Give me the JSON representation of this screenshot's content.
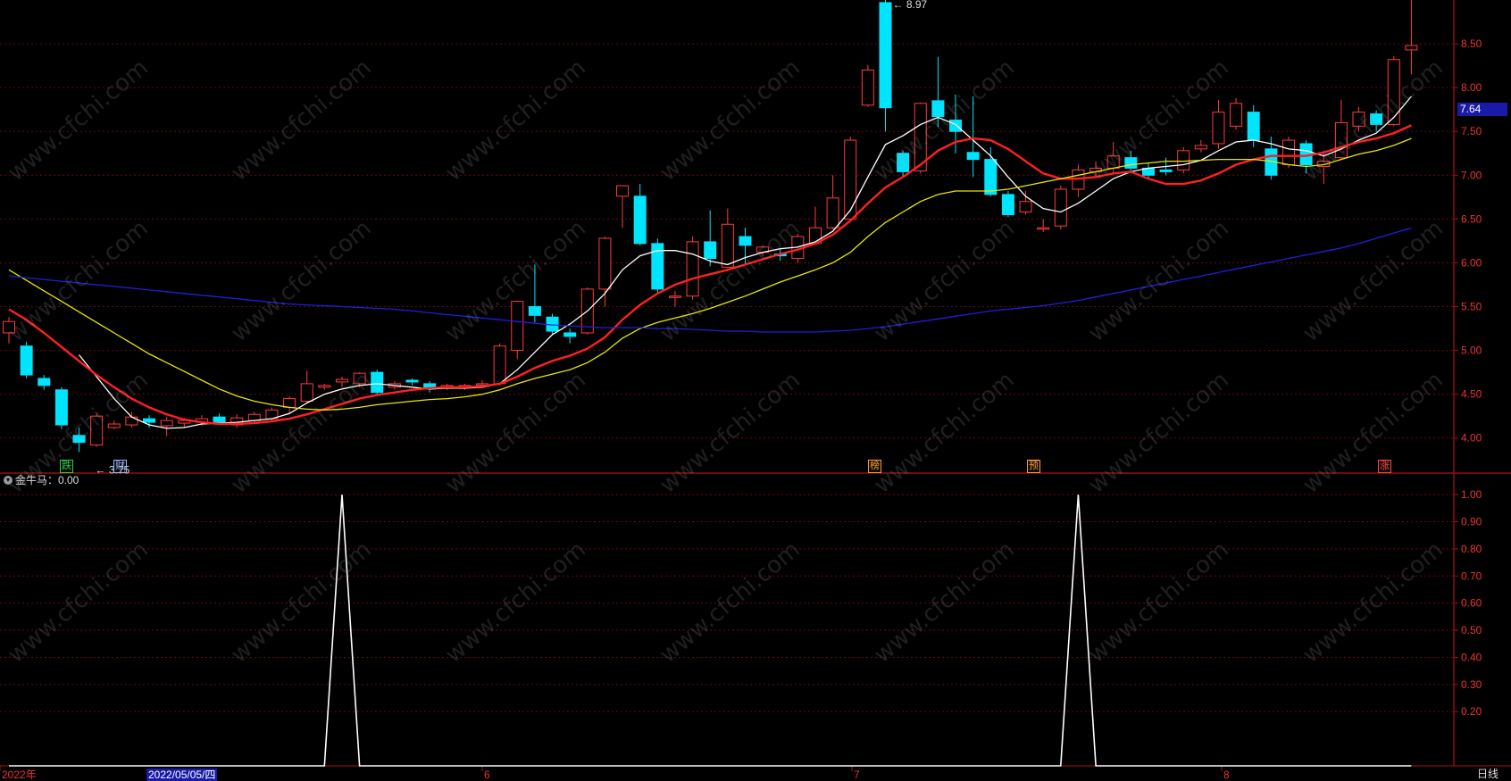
{
  "watermark": "www.cfchi.com",
  "indicator": {
    "label": "金牛马：0.00"
  },
  "price_tag": "7.64",
  "period_label": "日线",
  "cursor_date": "2022/05/05/四",
  "tags": [
    {
      "text": "跌",
      "color": "#2ecc40"
    },
    {
      "text": "财",
      "color": "#8fb3ff"
    },
    {
      "text": "榜",
      "color": "#ff9933"
    },
    {
      "text": "预",
      "color": "#ff9933"
    },
    {
      "text": "涨",
      "color": "#ff4444"
    }
  ],
  "chart_data": [
    {
      "type": "candlestick",
      "ylim": [
        3.6,
        9.0
      ],
      "yticks": [
        "4.00",
        "4.50",
        "5.00",
        "5.50",
        "6.00",
        "6.50",
        "7.00",
        "7.50",
        "8.00",
        "8.50"
      ],
      "xticks": [
        "2022年",
        "6",
        "7",
        "8"
      ],
      "high_annotation": "8.97",
      "low_annotation": "3.75",
      "candles": [
        [
          5.2,
          5.33,
          5.38,
          5.08
        ],
        [
          5.05,
          4.72,
          5.1,
          4.68
        ],
        [
          4.68,
          4.6,
          4.72,
          4.55
        ],
        [
          4.55,
          4.15,
          4.58,
          4.1
        ],
        [
          4.03,
          3.95,
          4.12,
          3.84
        ],
        [
          3.92,
          4.25,
          4.28,
          3.9
        ],
        [
          4.12,
          4.16,
          4.2,
          4.1
        ],
        [
          4.15,
          4.24,
          4.3,
          4.12
        ],
        [
          4.22,
          4.18,
          4.26,
          4.12
        ],
        [
          4.14,
          4.2,
          4.24,
          4.02
        ],
        [
          4.17,
          4.2,
          4.23,
          4.12
        ],
        [
          4.18,
          4.22,
          4.26,
          4.14
        ],
        [
          4.24,
          4.18,
          4.28,
          4.16
        ],
        [
          4.15,
          4.23,
          4.27,
          4.12
        ],
        [
          4.2,
          4.27,
          4.3,
          4.16
        ],
        [
          4.22,
          4.32,
          4.35,
          4.2
        ],
        [
          4.35,
          4.45,
          4.48,
          4.28
        ],
        [
          4.42,
          4.62,
          4.77,
          4.4
        ],
        [
          4.58,
          4.6,
          4.62,
          4.55
        ],
        [
          4.64,
          4.67,
          4.7,
          4.58
        ],
        [
          4.62,
          4.74,
          4.75,
          4.58
        ],
        [
          4.75,
          4.52,
          4.78,
          4.5
        ],
        [
          4.58,
          4.62,
          4.65,
          4.55
        ],
        [
          4.66,
          4.64,
          4.68,
          4.6
        ],
        [
          4.62,
          4.56,
          4.65,
          4.52
        ],
        [
          4.58,
          4.6,
          4.62,
          4.55
        ],
        [
          4.58,
          4.6,
          4.62,
          4.55
        ],
        [
          4.62,
          4.62,
          4.66,
          4.6
        ],
        [
          4.62,
          5.05,
          5.08,
          4.6
        ],
        [
          5.0,
          5.56,
          5.57,
          4.9
        ],
        [
          5.5,
          5.4,
          5.98,
          5.32
        ],
        [
          5.38,
          5.22,
          5.42,
          5.18
        ],
        [
          5.2,
          5.16,
          5.25,
          5.08
        ],
        [
          5.2,
          5.7,
          5.72,
          5.18
        ],
        [
          5.7,
          6.28,
          6.3,
          5.5
        ],
        [
          6.76,
          6.88,
          6.88,
          6.4
        ],
        [
          6.76,
          6.22,
          6.9,
          6.2
        ],
        [
          6.22,
          5.7,
          6.28,
          5.65
        ],
        [
          5.62,
          5.62,
          5.68,
          5.5
        ],
        [
          5.62,
          6.24,
          6.3,
          5.58
        ],
        [
          6.24,
          6.05,
          6.6,
          5.96
        ],
        [
          5.95,
          6.44,
          6.62,
          5.94
        ],
        [
          6.3,
          6.2,
          6.4,
          5.98
        ],
        [
          6.12,
          6.18,
          6.2,
          6.08
        ],
        [
          6.1,
          6.08,
          6.15,
          6.02
        ],
        [
          6.05,
          6.3,
          6.33,
          6.0
        ],
        [
          6.22,
          6.4,
          6.64,
          6.2
        ],
        [
          6.4,
          6.74,
          7.0,
          6.38
        ],
        [
          6.5,
          7.4,
          7.44,
          6.5
        ],
        [
          7.8,
          8.2,
          8.26,
          7.78
        ],
        [
          8.97,
          7.77,
          9.0,
          7.5
        ],
        [
          7.25,
          7.04,
          7.28,
          6.98
        ],
        [
          7.05,
          7.82,
          7.83,
          7.02
        ],
        [
          7.85,
          7.67,
          8.35,
          7.55
        ],
        [
          7.63,
          7.5,
          7.92,
          7.25
        ],
        [
          7.26,
          7.18,
          7.9,
          6.98
        ],
        [
          7.18,
          6.78,
          7.32,
          6.76
        ],
        [
          6.78,
          6.55,
          6.82,
          6.52
        ],
        [
          6.58,
          6.7,
          6.82,
          6.55
        ],
        [
          6.4,
          6.4,
          6.5,
          6.35
        ],
        [
          6.42,
          6.84,
          6.88,
          6.38
        ],
        [
          6.84,
          7.06,
          7.12,
          6.75
        ],
        [
          7.04,
          7.08,
          7.16,
          6.98
        ],
        [
          7.08,
          7.22,
          7.38,
          7.02
        ],
        [
          7.2,
          7.08,
          7.28,
          7.02
        ],
        [
          7.08,
          7.0,
          7.14,
          6.95
        ],
        [
          7.06,
          7.04,
          7.2,
          7.0
        ],
        [
          7.06,
          7.28,
          7.32,
          7.02
        ],
        [
          7.3,
          7.34,
          7.4,
          7.26
        ],
        [
          7.36,
          7.72,
          7.86,
          7.3
        ],
        [
          7.56,
          7.82,
          7.88,
          7.52
        ],
        [
          7.72,
          7.4,
          7.8,
          7.32
        ],
        [
          7.3,
          7.0,
          7.44,
          6.95
        ],
        [
          7.12,
          7.4,
          7.44,
          7.08
        ],
        [
          7.36,
          7.12,
          7.4,
          7.02
        ],
        [
          7.1,
          7.16,
          7.28,
          6.9
        ],
        [
          7.2,
          7.6,
          7.86,
          7.18
        ],
        [
          7.56,
          7.72,
          7.78,
          7.5
        ],
        [
          7.7,
          7.58,
          7.74,
          7.5
        ],
        [
          7.58,
          8.32,
          8.36,
          7.56
        ],
        [
          8.43,
          8.48,
          9.0,
          8.15
        ]
      ],
      "series": [
        {
          "color": "#ffffff",
          "values": [
            null,
            null,
            null,
            null,
            4.95,
            4.7,
            4.45,
            4.24,
            4.15,
            4.11,
            4.12,
            4.16,
            4.17,
            4.18,
            4.2,
            4.22,
            4.28,
            4.4,
            4.5,
            4.56,
            4.6,
            4.62,
            4.6,
            4.58,
            4.56,
            4.57,
            4.57,
            4.58,
            4.62,
            4.78,
            4.98,
            5.18,
            5.3,
            5.45,
            5.65,
            5.92,
            6.08,
            6.14,
            6.14,
            6.1,
            6.02,
            5.98,
            6.06,
            6.12,
            6.16,
            6.18,
            6.24,
            6.36,
            6.6,
            6.98,
            7.35,
            7.45,
            7.58,
            7.66,
            7.58,
            7.4,
            7.22,
            6.98,
            6.76,
            6.62,
            6.58,
            6.68,
            6.82,
            6.96,
            7.04,
            7.08,
            7.1,
            7.12,
            7.17,
            7.28,
            7.38,
            7.4,
            7.36,
            7.3,
            7.28,
            7.22,
            7.3,
            7.4,
            7.48,
            7.66,
            7.9
          ]
        },
        {
          "color": "#ff2020",
          "values": [
            5.47,
            5.35,
            5.2,
            5.04,
            4.88,
            4.72,
            4.58,
            4.45,
            4.35,
            4.27,
            4.21,
            4.18,
            4.16,
            4.16,
            4.17,
            4.19,
            4.22,
            4.27,
            4.33,
            4.39,
            4.45,
            4.49,
            4.52,
            4.55,
            4.57,
            4.58,
            4.58,
            4.59,
            4.62,
            4.7,
            4.8,
            4.88,
            4.94,
            5.02,
            5.15,
            5.35,
            5.52,
            5.65,
            5.75,
            5.82,
            5.87,
            5.92,
            5.98,
            6.04,
            6.1,
            6.15,
            6.22,
            6.32,
            6.48,
            6.68,
            6.86,
            6.98,
            7.12,
            7.28,
            7.38,
            7.42,
            7.4,
            7.3,
            7.16,
            7.02,
            6.96,
            6.96,
            6.98,
            7.02,
            7.04,
            6.96,
            6.9,
            6.9,
            6.94,
            7.02,
            7.12,
            7.18,
            7.22,
            7.22,
            7.22,
            7.26,
            7.32,
            7.38,
            7.42,
            7.48,
            7.57
          ]
        },
        {
          "color": "#e8e800",
          "values": [
            5.92,
            5.8,
            5.68,
            5.56,
            5.44,
            5.32,
            5.2,
            5.08,
            4.96,
            4.86,
            4.76,
            4.66,
            4.56,
            4.48,
            4.42,
            4.38,
            4.35,
            4.33,
            4.32,
            4.33,
            4.35,
            4.38,
            4.4,
            4.42,
            4.44,
            4.45,
            4.47,
            4.5,
            4.55,
            4.62,
            4.68,
            4.73,
            4.78,
            4.86,
            4.98,
            5.14,
            5.25,
            5.32,
            5.37,
            5.42,
            5.48,
            5.55,
            5.62,
            5.7,
            5.78,
            5.85,
            5.92,
            6.0,
            6.12,
            6.3,
            6.46,
            6.58,
            6.7,
            6.78,
            6.82,
            6.82,
            6.82,
            6.84,
            6.88,
            6.92,
            6.96,
            7.0,
            7.04,
            7.08,
            7.12,
            7.14,
            7.16,
            7.16,
            7.17,
            7.18,
            7.18,
            7.18,
            7.16,
            7.12,
            7.1,
            7.12,
            7.18,
            7.24,
            7.28,
            7.34,
            7.42
          ]
        },
        {
          "color": "#1f1fdd",
          "values": [
            5.85,
            5.83,
            5.81,
            5.79,
            5.77,
            5.75,
            5.73,
            5.71,
            5.69,
            5.67,
            5.65,
            5.63,
            5.61,
            5.59,
            5.57,
            5.55,
            5.53,
            5.52,
            5.51,
            5.5,
            5.49,
            5.48,
            5.47,
            5.45,
            5.43,
            5.41,
            5.39,
            5.37,
            5.35,
            5.33,
            5.31,
            5.29,
            5.28,
            5.27,
            5.26,
            5.26,
            5.26,
            5.25,
            5.25,
            5.24,
            5.23,
            5.22,
            5.22,
            5.21,
            5.21,
            5.21,
            5.21,
            5.22,
            5.23,
            5.25,
            5.27,
            5.3,
            5.33,
            5.36,
            5.39,
            5.42,
            5.45,
            5.47,
            5.49,
            5.51,
            5.54,
            5.57,
            5.61,
            5.65,
            5.69,
            5.73,
            5.77,
            5.81,
            5.85,
            5.89,
            5.93,
            5.97,
            6.01,
            6.05,
            6.09,
            6.13,
            6.17,
            6.22,
            6.28,
            6.34,
            6.4
          ]
        }
      ]
    },
    {
      "type": "line",
      "series_name": "金牛马",
      "ylim": [
        0,
        1.04
      ],
      "yticks": [
        "0.20",
        "0.30",
        "0.40",
        "0.50",
        "0.60",
        "0.70",
        "0.80",
        "0.90",
        "1.00"
      ],
      "values": [
        0,
        0,
        0,
        0,
        0,
        0,
        0,
        0,
        0,
        0,
        0,
        0,
        0,
        0,
        0,
        0,
        0,
        0,
        0,
        1,
        0,
        0,
        0,
        0,
        0,
        0,
        0,
        0,
        0,
        0,
        0,
        0,
        0,
        0,
        0,
        0,
        0,
        0,
        0,
        0,
        0,
        0,
        0,
        0,
        0,
        0,
        0,
        0,
        0,
        0,
        0,
        0,
        0,
        0,
        0,
        0,
        0,
        0,
        0,
        0,
        0,
        1,
        0,
        0,
        0,
        0,
        0,
        0,
        0,
        0,
        0,
        0,
        0,
        0,
        0,
        0,
        0,
        0,
        0,
        0,
        0
      ]
    }
  ]
}
